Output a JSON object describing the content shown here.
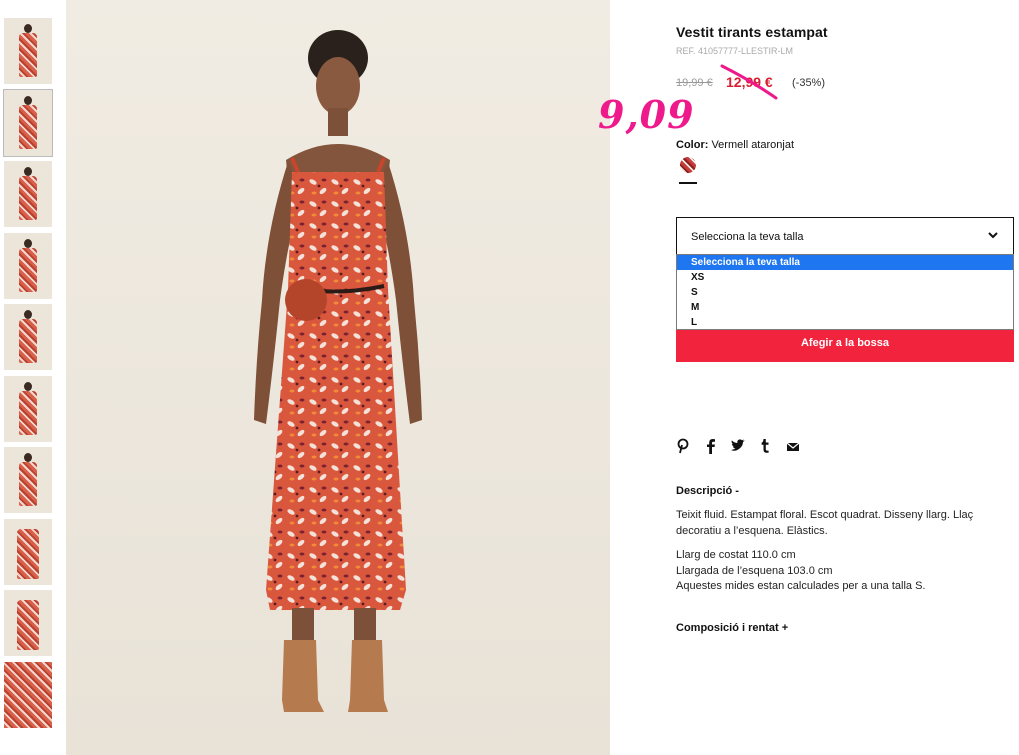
{
  "product": {
    "title": "Vestit tirants estampat",
    "ref": "REF. 41057777-LLESTIR-LM",
    "old_price": "19,99 €",
    "sale_price": "12,99 €",
    "discount": "(-35%)",
    "handwritten_price": "9,09",
    "handwritten_color": "#ee1a8c",
    "sale_color": "#d81f31"
  },
  "color": {
    "label": "Color:",
    "value": "Vermell ataronjat",
    "swatch_icon": "floral-swatch-icon"
  },
  "size": {
    "placeholder": "Selecciona la teva talla",
    "options": [
      "Selecciona la teva talla",
      "XS",
      "S",
      "M",
      "L"
    ],
    "highlighted": "Selecciona la teva talla"
  },
  "cart": {
    "add_label": "Afegir a la bossa",
    "button_color": "#f1233d"
  },
  "share_icons": [
    "pinterest-icon",
    "facebook-icon",
    "twitter-icon",
    "tumblr-icon",
    "mail-icon"
  ],
  "description": {
    "title": "Descripció -",
    "text": "Teixit fluid. Estampat floral. Escot quadrat. Disseny llarg. Llaç decoratiu a l’esquena. Elàstics.",
    "measure_1": "Llarg de costat 110.0 cm",
    "measure_2": "Llargada de l’esquena 103.0 cm",
    "measure_3": "Aquestes mides estan calculades per a una talla S."
  },
  "composition": {
    "title": "Composició i rentat +"
  }
}
